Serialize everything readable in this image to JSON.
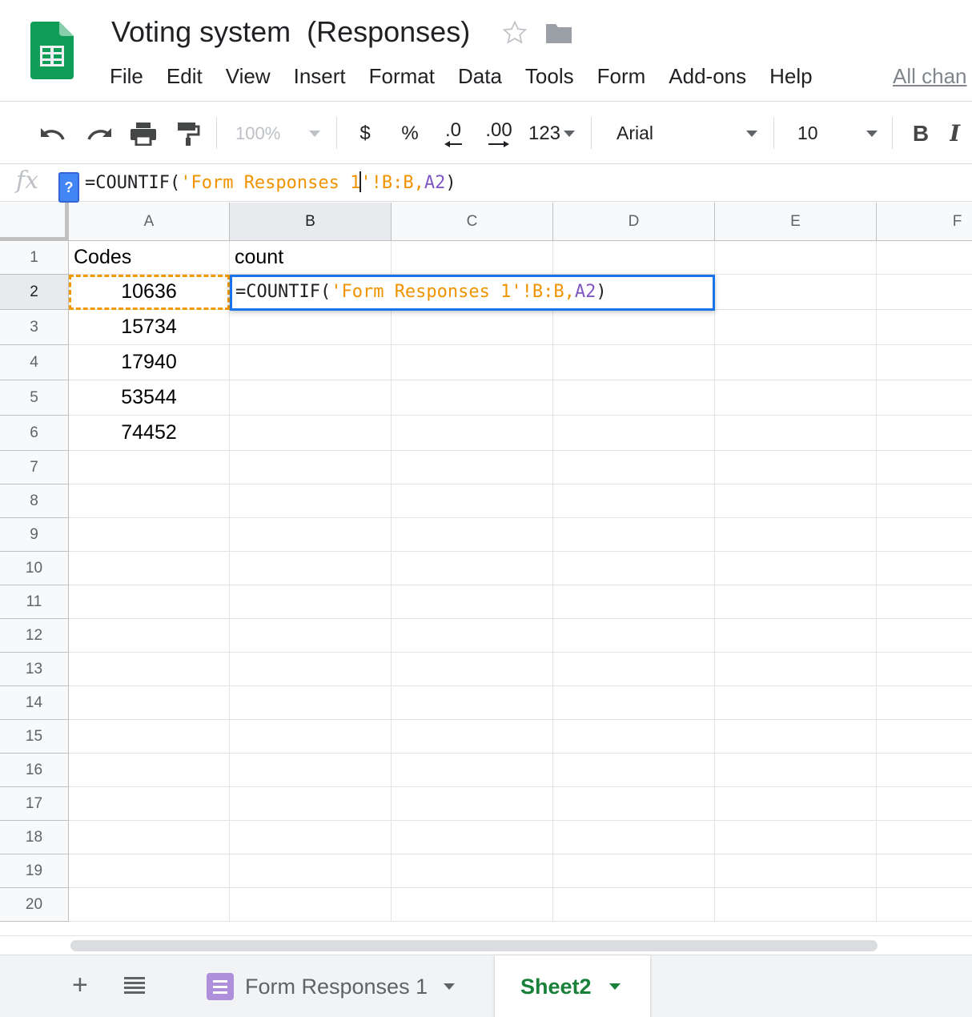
{
  "app": {
    "title": "Voting system  (Responses)",
    "all_changes": "All chan"
  },
  "menu": [
    "File",
    "Edit",
    "View",
    "Insert",
    "Format",
    "Data",
    "Tools",
    "Form",
    "Add-ons",
    "Help"
  ],
  "toolbar": {
    "zoom": "100%",
    "currency": "$",
    "percent": "%",
    "decrease_decimal": ".0",
    "increase_decimal": ".00",
    "more_formats": "123",
    "font": "Arial",
    "font_size": "10",
    "bold": "B",
    "italic": "I"
  },
  "formula_bar": {
    "fx": "fx",
    "help": "?",
    "formula_part1": "=COUNTIF(",
    "formula_part2": "'Form Responses 1",
    "formula_part3": "'",
    "formula_part4": "!B:B,",
    "formula_part5": "A2",
    "formula_part6": ")"
  },
  "grid": {
    "columns": [
      "A",
      "B",
      "C",
      "D",
      "E",
      "F"
    ],
    "active_column": "B",
    "active_row": "2",
    "rows": [
      "1",
      "2",
      "3",
      "4",
      "5",
      "6",
      "7",
      "8",
      "9",
      "10",
      "11",
      "12",
      "13",
      "14",
      "15",
      "16",
      "17",
      "18",
      "19",
      "20"
    ],
    "cells": {
      "A1": "Codes",
      "B1": "count",
      "A2": "10636",
      "A3": "15734",
      "A4": "17940",
      "A5": "53544",
      "A6": "74452"
    },
    "editor": {
      "part1": "=COUNTIF(",
      "part2": "'Form Responses 1'",
      "part3": "!B:B,",
      "part4": "A2",
      "part5": ")"
    }
  },
  "sheet_tabs": {
    "add": "+",
    "tabs": [
      {
        "label": "Form Responses 1",
        "active": false
      },
      {
        "label": "Sheet2",
        "active": true
      }
    ]
  },
  "colors": {
    "sheets_green": "#0f9d58",
    "selection_blue": "#1a73e8",
    "copy_orange": "#f29900",
    "formula_orange": "#f09300",
    "formula_purple": "#7e57c2",
    "active_tab_green": "#188038",
    "form_icon_purple": "#ad8fdb"
  }
}
